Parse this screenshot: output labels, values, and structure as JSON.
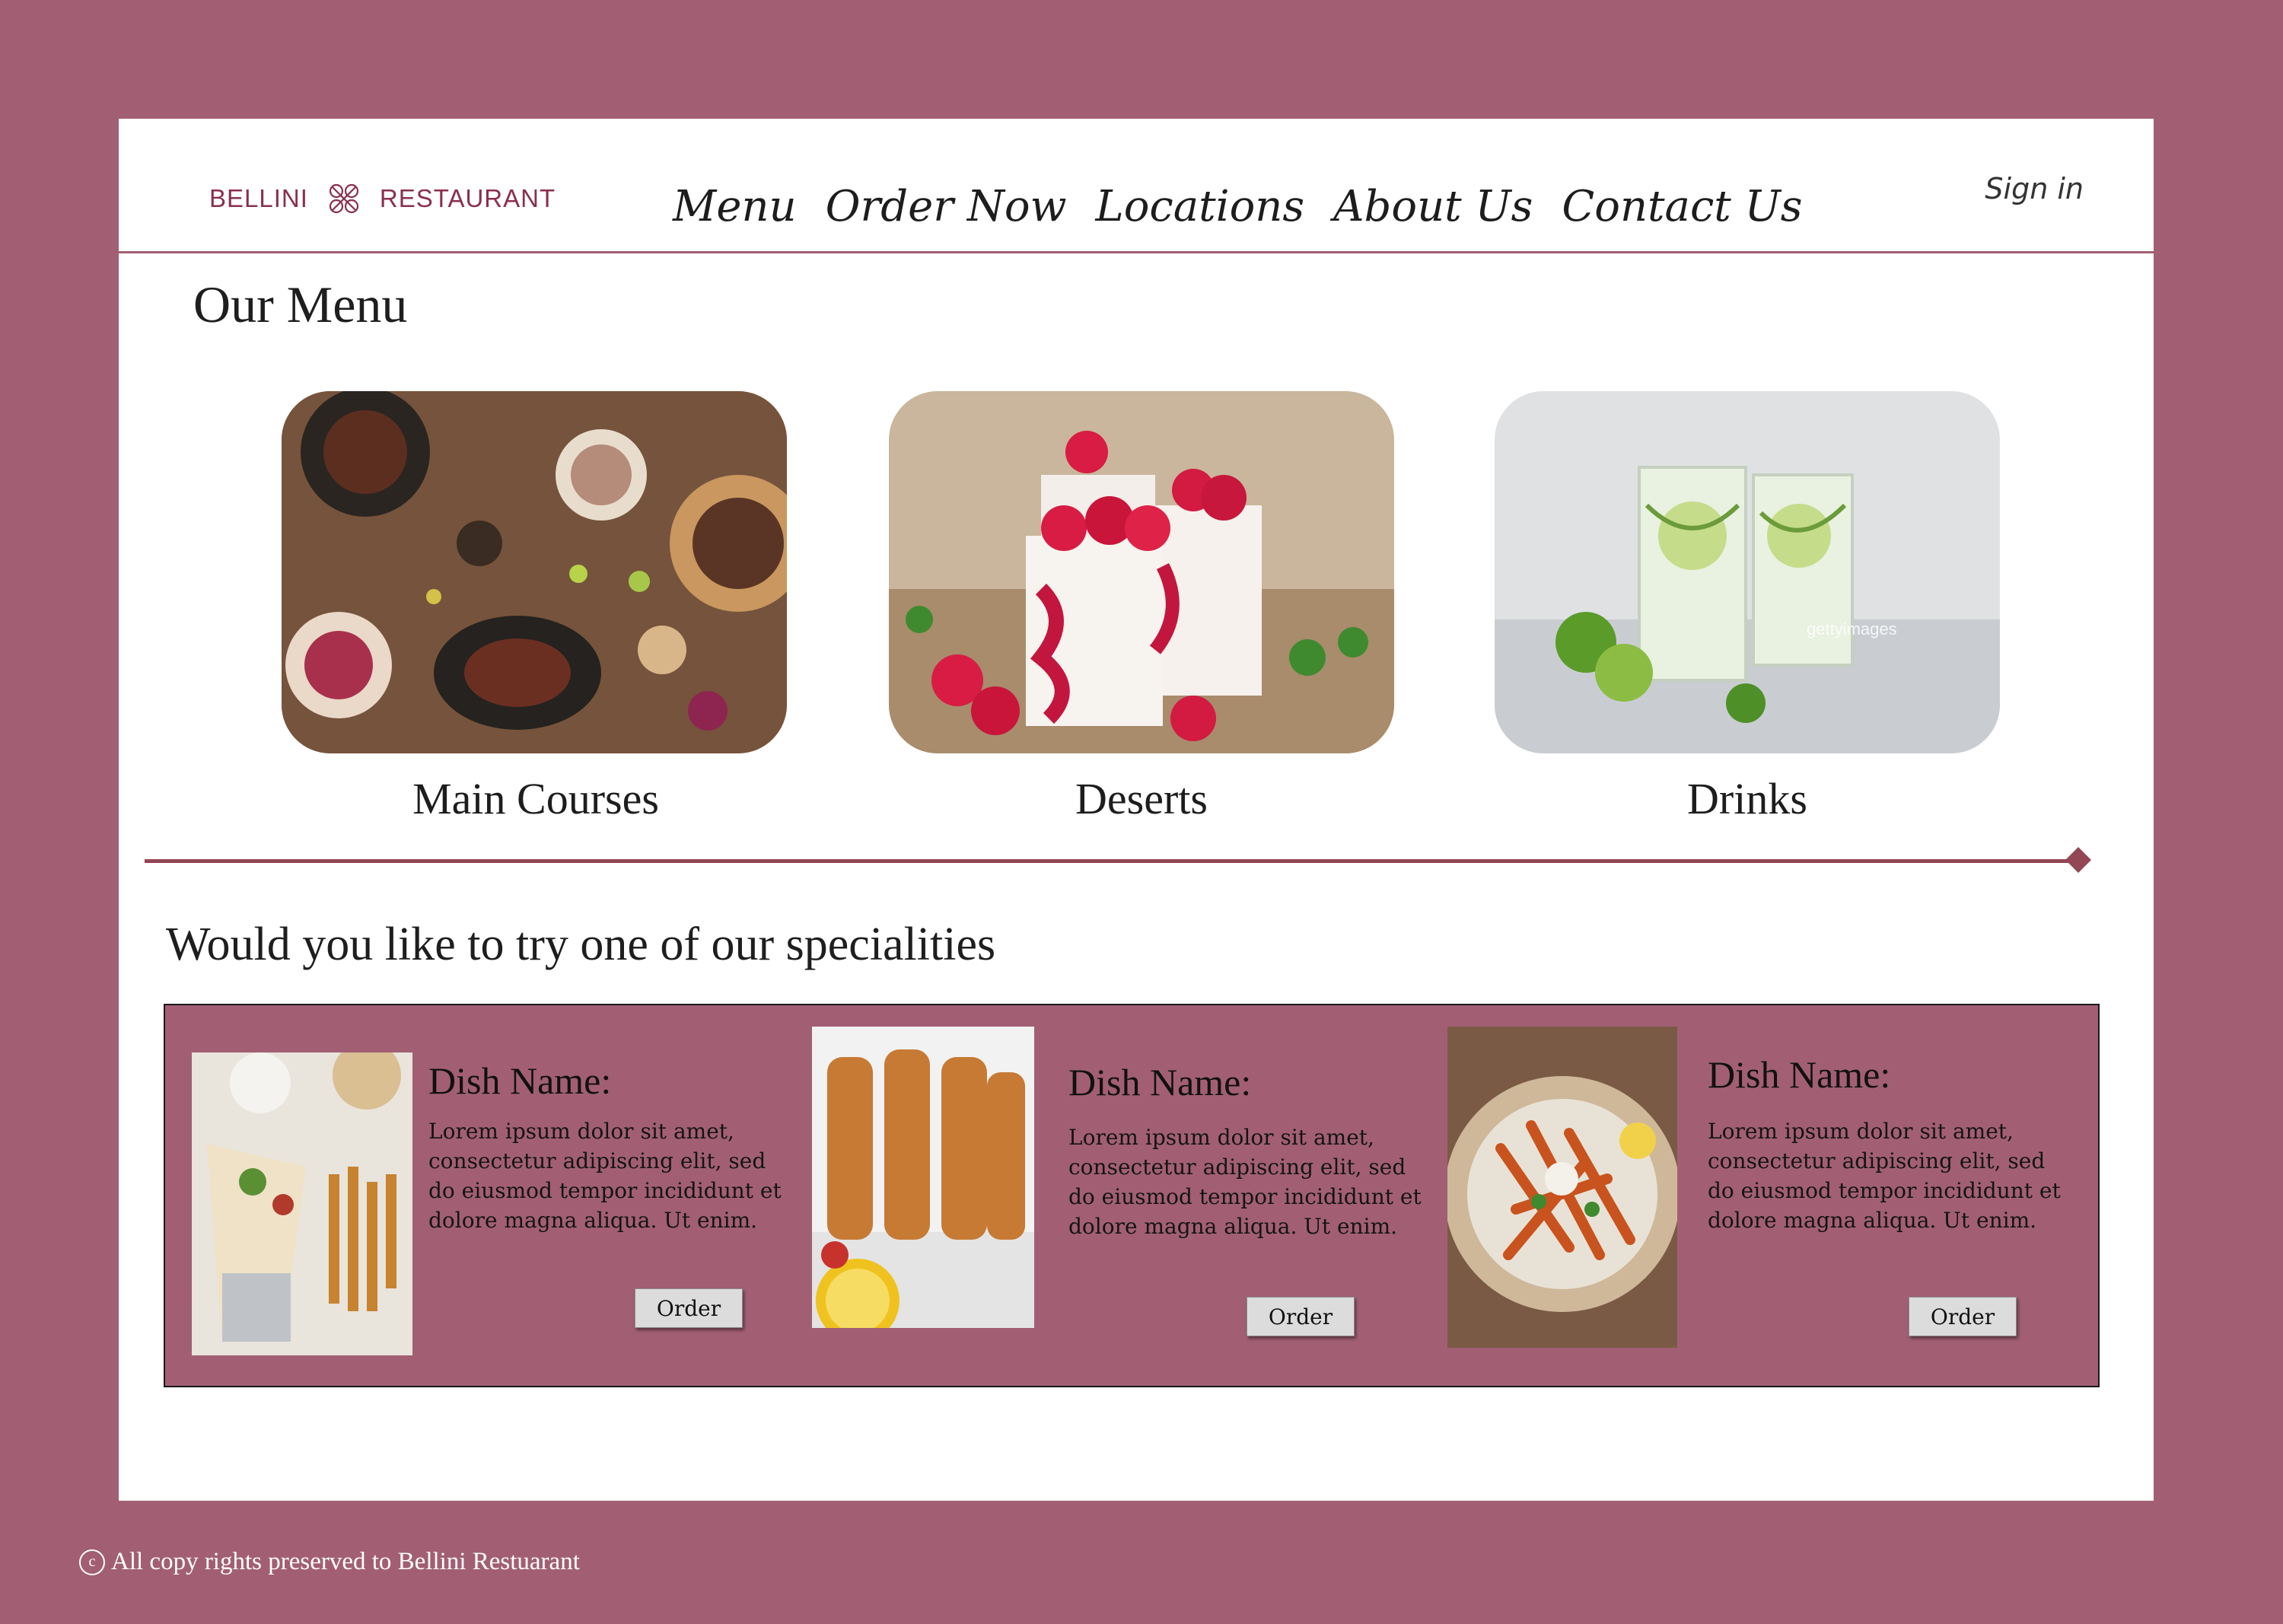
{
  "brand": {
    "left": "BELLINI",
    "right": "RESTAURANT",
    "logo_icon": "ornament-logo-icon"
  },
  "nav": {
    "items": [
      "Menu",
      "Order Now",
      "Locations",
      "About Us",
      "Contact Us"
    ]
  },
  "header": {
    "signin_label": "Sign in"
  },
  "menu": {
    "title": "Our Menu",
    "categories": [
      {
        "label": "Main Courses",
        "image": "main-courses-photo"
      },
      {
        "label": "Deserts",
        "image": "raspberry-dessert-photo"
      },
      {
        "label": "Drinks",
        "image": "cucumber-lime-drinks-photo"
      }
    ]
  },
  "specials": {
    "title": "Would you like to try one of our specialities",
    "dishes": [
      {
        "name": "Dish Name:",
        "description": "Lorem ipsum dolor sit amet, consectetur adipiscing elit, sed do eiusmod tempor incididunt et dolore magna aliqua. Ut enim.",
        "order_label": "Order",
        "image": "shawarma-wrap-photo"
      },
      {
        "name": "Dish Name:",
        "description": "Lorem ipsum dolor sit amet, consectetur adipiscing elit, sed do eiusmod tempor incididunt et dolore magna aliqua. Ut enim.",
        "order_label": "Order",
        "image": "chicken-skewers-photo"
      },
      {
        "name": "Dish Name:",
        "description": "Lorem ipsum dolor sit amet, consectetur adipiscing elit, sed do eiusmod tempor incididunt et dolore magna aliqua. Ut enim.",
        "order_label": "Order",
        "image": "loaded-fries-photo"
      }
    ]
  },
  "footer": {
    "copyright_icon": "copyright-icon",
    "text": "All copy rights preserved to Bellini Restuarant"
  },
  "colors": {
    "background": "#a25f74",
    "brand": "#8a2f4e",
    "divider": "#934654",
    "panel": "#ffffff"
  }
}
